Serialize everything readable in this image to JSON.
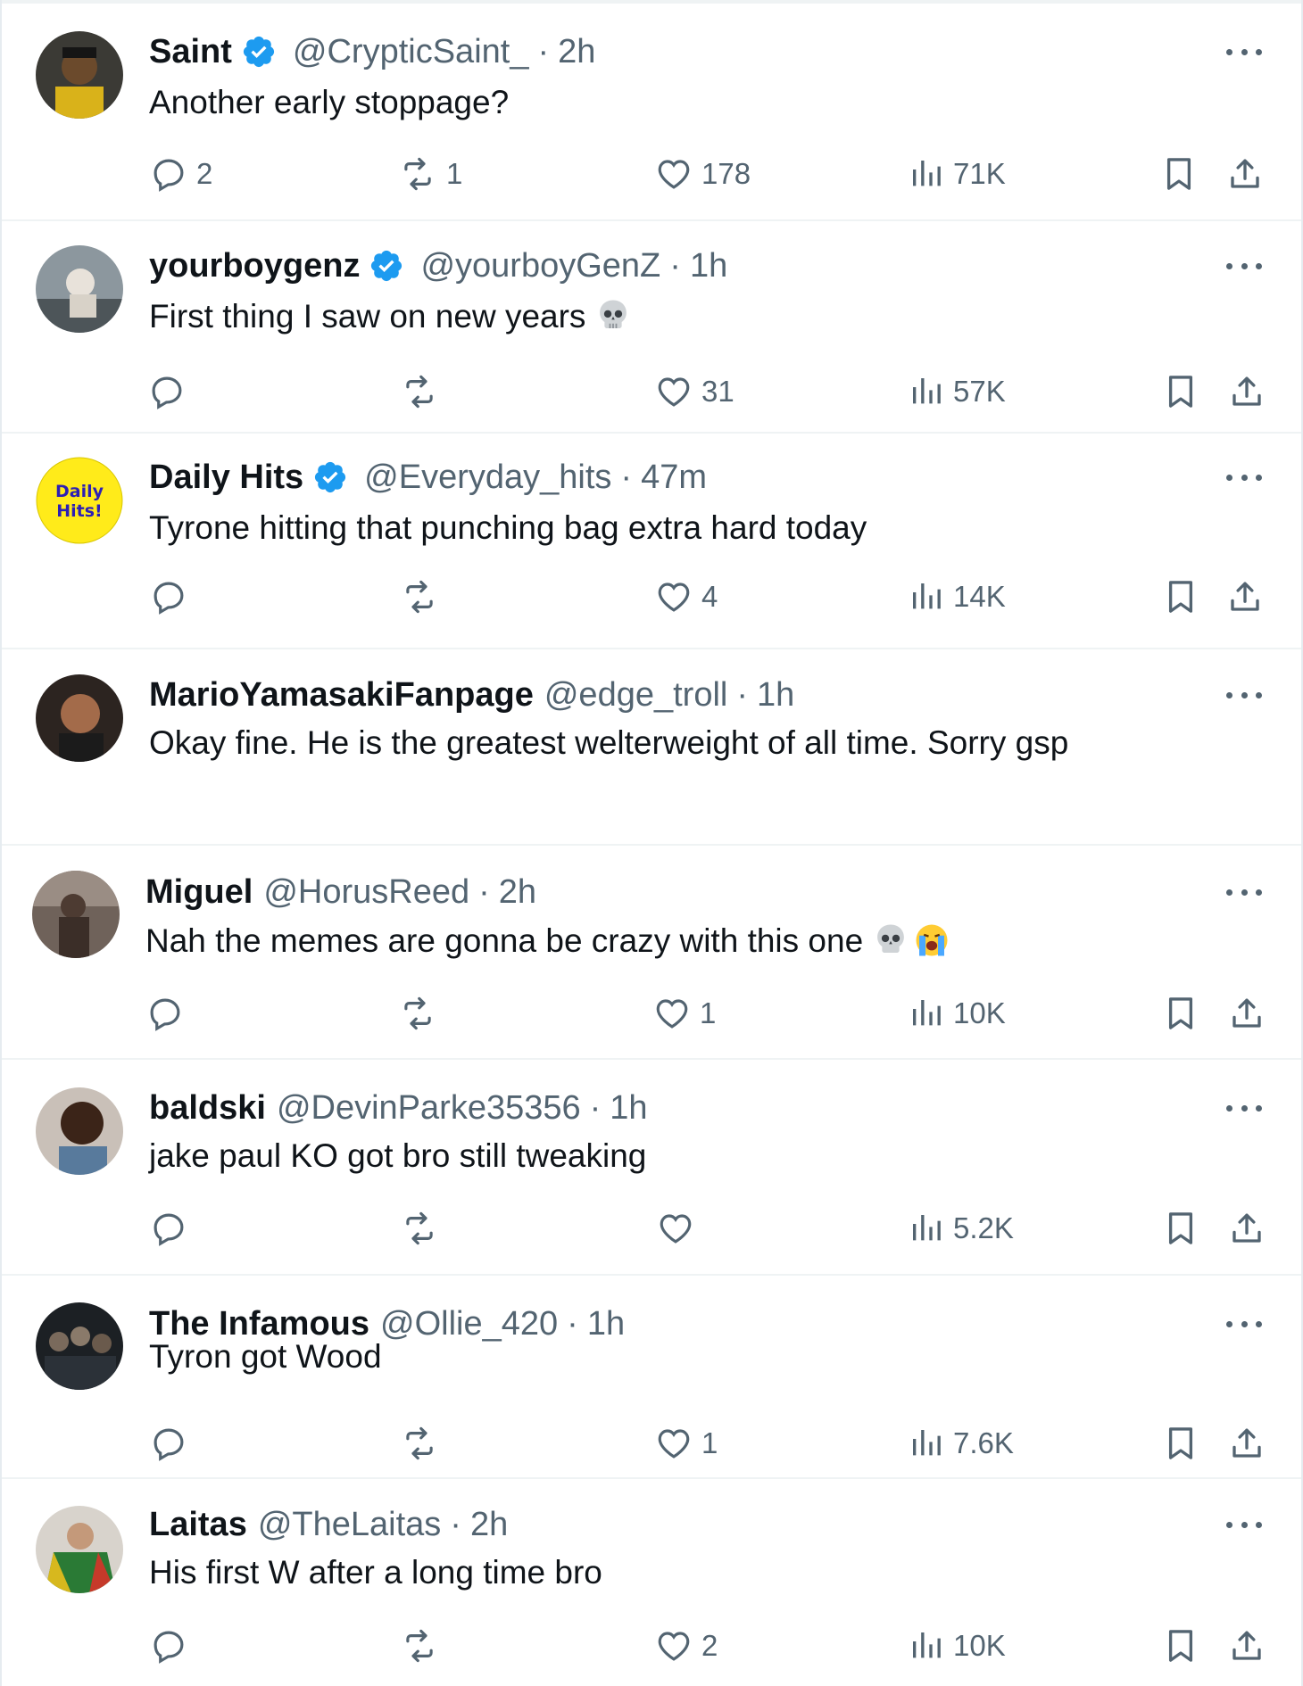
{
  "tweets": [
    {
      "name": "Saint",
      "verified": true,
      "handle": "@CrypticSaint_",
      "time": "2h",
      "text": "Another early stoppage?",
      "emojis": [],
      "replies": "2",
      "reposts": "1",
      "likes": "178",
      "views": "71K",
      "avatar_color": "#2b2a28"
    },
    {
      "name": "yourboygenz",
      "verified": true,
      "handle": "@yourboyGenZ",
      "time": "1h",
      "text": "First thing I saw on new years",
      "emojis": [
        "skull"
      ],
      "replies": "",
      "reposts": "",
      "likes": "31",
      "views": "57K",
      "avatar_color": "#7c8a93"
    },
    {
      "name": "Daily Hits",
      "verified": true,
      "handle": "@Everyday_hits",
      "time": "47m",
      "text": "Tyrone hitting that punching bag extra hard today",
      "emojis": [],
      "replies": "",
      "reposts": "",
      "likes": "4",
      "views": "14K",
      "avatar_color": "#ffeb1a",
      "avatar_text_1": "Daily",
      "avatar_text_2": "Hits!"
    },
    {
      "name": "MarioYamasakiFanpage",
      "verified": false,
      "handle": "@edge_troll",
      "time": "1h",
      "text": "Okay fine. He is the greatest welterweight of all time. Sorry gsp",
      "emojis": [],
      "avatar_color": "#3a2e28"
    },
    {
      "name": "Miguel",
      "verified": false,
      "handle": "@HorusReed",
      "time": "2h",
      "text": "Nah the memes are gonna be crazy with this one",
      "emojis": [
        "skull",
        "crying"
      ],
      "replies": "",
      "reposts": "",
      "likes": "1",
      "views": "10K",
      "avatar_color": "#5a4d45"
    },
    {
      "name": "baldski",
      "verified": false,
      "handle": "@DevinParke35356",
      "time": "1h",
      "text": "jake paul KO got bro still tweaking",
      "emojis": [],
      "replies": "",
      "reposts": "",
      "likes": "",
      "views": "5.2K",
      "avatar_color": "#6b4a3a"
    },
    {
      "name": "The Infamous",
      "verified": false,
      "handle": "@Ollie_420",
      "time": "1h",
      "text": "Tyron got Wood",
      "emojis": [],
      "replies": "",
      "reposts": "",
      "likes": "1",
      "views": "7.6K",
      "avatar_color": "#1e2226"
    },
    {
      "name": "Laitas",
      "verified": false,
      "handle": "@TheLaitas",
      "time": "2h",
      "text": "His first W after a long time bro",
      "emojis": [],
      "replies": "",
      "reposts": "",
      "likes": "2",
      "views": "10K",
      "avatar_color": "#c9c4bd"
    }
  ],
  "colors": {
    "text": "#0f1419",
    "muted": "#536471",
    "verified_blue": "#1d9bf0",
    "divider": "#eff3f4"
  },
  "icons": {
    "reply": "reply-icon",
    "repost": "repost-icon",
    "like": "like-icon",
    "views": "views-icon",
    "bookmark": "bookmark-icon",
    "share": "share-icon",
    "more": "more-icon",
    "verified": "verified-badge-icon"
  }
}
